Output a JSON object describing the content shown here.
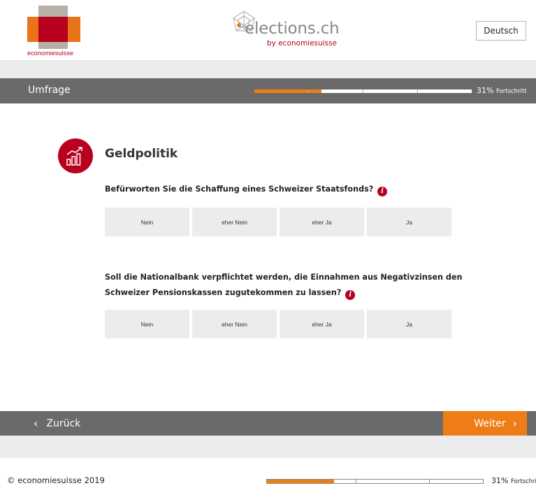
{
  "header": {
    "brand": "economiesuisse",
    "site_title": "elections.ch",
    "site_subtitle": "by economiesuisse",
    "language_button": "Deutsch"
  },
  "survey": {
    "title": "Umfrage",
    "progress_percent": 31,
    "progress_value": "31%",
    "progress_label": "Fortschritt"
  },
  "topic": {
    "icon": "rising-chart-icon",
    "title": "Geldpolitik"
  },
  "questions": [
    {
      "text": "Befürworten Sie die Schaffung eines Schweizer Staatsfonds?",
      "info_icon": "info-icon",
      "options": [
        "Nein",
        "eher Nein",
        "eher Ja",
        "Ja"
      ]
    },
    {
      "text_line1": "Soll die Nationalbank verpflichtet werden, die Einnahmen aus Negativzinsen den",
      "text_line2": "Schweizer Pensionskassen zugutekommen zu lassen?",
      "info_icon": "info-icon",
      "options": [
        "Nein",
        "eher Nein",
        "eher Ja",
        "Ja"
      ]
    }
  ],
  "nav": {
    "back_label": "Zurück",
    "next_label": "Weiter"
  },
  "footer": {
    "copyright": "© economiesuisse 2019",
    "progress_value": "31%",
    "progress_label": "Fortschri"
  },
  "colors": {
    "brand_red": "#b9001e",
    "brand_orange": "#ee7d15",
    "bar_gray": "#6a6a6a",
    "light_gray": "#ececec"
  }
}
